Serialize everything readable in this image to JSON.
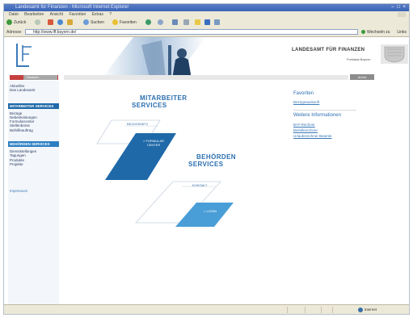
{
  "window": {
    "title": "Landesamt für Finanzen - Microsoft Internet Explorer"
  },
  "menu": [
    "Datei",
    "Bearbeiten",
    "Ansicht",
    "Favoriten",
    "Extras",
    "?"
  ],
  "toolbar": {
    "back_label": "Zurück",
    "search_label": "Suchen",
    "favorites_label": "Favoriten"
  },
  "address": {
    "label": "Adresse",
    "url": "http://www.lff.bayern.de/",
    "go_label": "Wechseln zu",
    "links_label": "Links"
  },
  "header": {
    "agency_name": "LANDESAMT FÜR FINANZEN",
    "agency_sub": "Freistaat Bayern"
  },
  "navbar": {
    "lang_label": "Deutsch",
    "archiv_label": "Archiv"
  },
  "sidebar": {
    "top_items": [
      "Aktuelles",
      "Das Landesamt"
    ],
    "sections": [
      {
        "title": "MITARBEITER SERVICES",
        "items": [
          "Bezüge",
          "Nebenleistungen",
          "Formularcenter",
          "Stellenbörse",
          "Beihilfeauftrag"
        ]
      },
      {
        "title": "BEHÖRDEN SERVICES",
        "items": [
          "Dienststellungen",
          "Tagungen",
          "Produkte",
          "Projekte"
        ]
      }
    ],
    "bottom_link": "Impressum"
  },
  "main": {
    "mitarbeiter_heading_1": "MITARBEITER",
    "mitarbeiter_heading_2": "SERVICES",
    "btn_bezuegeinfo": "BEZÜGEINFO",
    "btn_formularcenter_1": "> FORMULAR",
    "btn_formularcenter_2": "CENTER",
    "behoerden_heading_1": "BEHÖRDEN",
    "behoerden_heading_2": "SERVICES",
    "btn_kontakt": "KONTAKT",
    "btn_login": "> LOGIN"
  },
  "right": {
    "favoriten_title": "Favoriten",
    "favoriten_link": "Bezügeauskunft",
    "info_title": "Weitere Informationen",
    "info_links": [
      "BAT-Rechner",
      "Beihilferechner",
      "Urlaubsrechner Beamte"
    ]
  },
  "status": {
    "zone_label": "Internet"
  },
  "colors": {
    "brand_dark": "#1f69a8",
    "brand_mid": "#2b7fc3",
    "brand_light": "#4a9ed8",
    "lang_red": "#c64040"
  }
}
